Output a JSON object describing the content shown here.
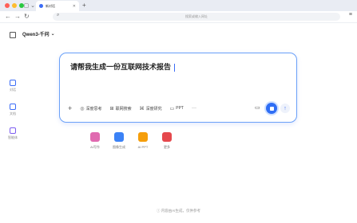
{
  "browser": {
    "tab_title": "新对话",
    "url_text": "搜索或输入网址",
    "colors": {
      "close": "#ff5f57",
      "min": "#febc2e",
      "max": "#28c840"
    }
  },
  "app": {
    "model_name": "Qwen3-千问",
    "sidebar": [
      {
        "label": "对话",
        "icon": "chat-icon"
      },
      {
        "label": "文档",
        "icon": "document-icon"
      },
      {
        "label": "智能体",
        "icon": "agent-icon"
      }
    ],
    "prompt_text": "请帮我生成一份互联网技术报告",
    "tools": [
      {
        "label": "深度思考",
        "icon": "brain-icon"
      },
      {
        "label": "联网搜索",
        "icon": "globe-icon"
      },
      {
        "label": "深度研究",
        "icon": "research-icon"
      },
      {
        "label": "PPT",
        "icon": "ppt-icon"
      }
    ],
    "suggestions": [
      {
        "label": "AI写作",
        "color": "#e06ab0"
      },
      {
        "label": "图像生成",
        "color": "#3b82f6"
      },
      {
        "label": "AI PPT",
        "color": "#f59e0b"
      },
      {
        "label": "更多",
        "color": "#e5484d"
      }
    ],
    "footer": "内容由AI生成，仅供参考"
  }
}
